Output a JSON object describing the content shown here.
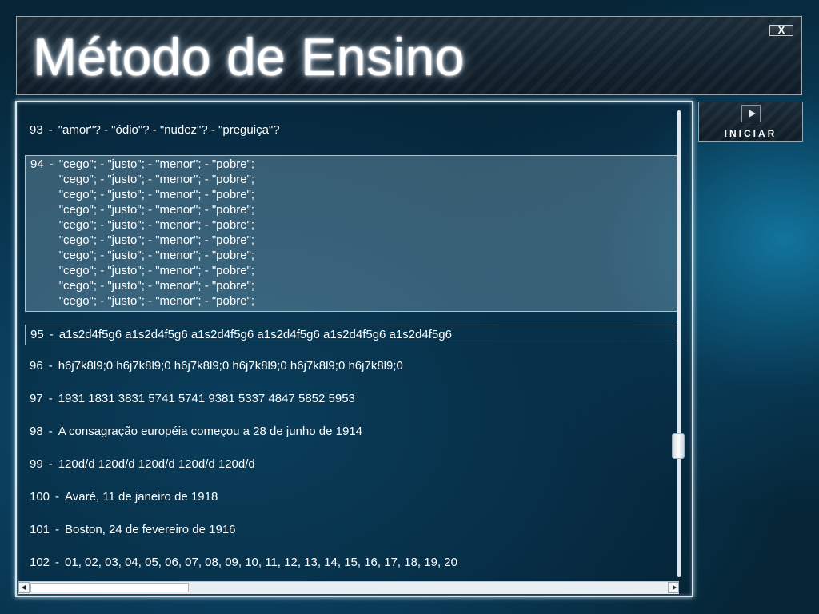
{
  "app": {
    "title": "Método de Ensino",
    "close_label": "X",
    "start_label": "INICIAR"
  },
  "icons": {
    "play": "play-icon",
    "scroll_left": "arrow-left-icon",
    "scroll_right": "arrow-right-icon"
  },
  "list": {
    "selected_number": "94",
    "items": [
      {
        "number": "93",
        "lines": [
          "\"amor\"? - \"ódio\"? - \"nudez\"? - \"preguiça\"?"
        ]
      },
      {
        "number": "94",
        "lines": [
          "\"cego\"; - \"justo\"; - \"menor\"; - \"pobre\";",
          "\"cego\"; - \"justo\"; - \"menor\"; - \"pobre\";",
          "\"cego\"; - \"justo\"; - \"menor\"; - \"pobre\";",
          "\"cego\"; - \"justo\"; - \"menor\"; - \"pobre\";",
          "\"cego\"; - \"justo\"; - \"menor\"; - \"pobre\";",
          "\"cego\"; - \"justo\"; - \"menor\"; - \"pobre\";",
          "\"cego\"; - \"justo\"; - \"menor\"; - \"pobre\";",
          "\"cego\"; - \"justo\"; - \"menor\"; - \"pobre\";",
          "\"cego\"; - \"justo\"; - \"menor\"; - \"pobre\";",
          "\"cego\"; - \"justo\"; - \"menor\"; - \"pobre\";"
        ]
      },
      {
        "number": "95",
        "lines": [
          "a1s2d4f5g6 a1s2d4f5g6 a1s2d4f5g6 a1s2d4f5g6 a1s2d4f5g6 a1s2d4f5g6"
        ]
      },
      {
        "number": "96",
        "lines": [
          "h6j7k8l9;0 h6j7k8l9;0 h6j7k8l9;0 h6j7k8l9;0 h6j7k8l9;0 h6j7k8l9;0"
        ]
      },
      {
        "number": "97",
        "lines": [
          "1931 1831 3831 5741 5741 9381 5337 4847 5852 5953"
        ]
      },
      {
        "number": "98",
        "lines": [
          "A consagração européia começou a 28 de junho de 1914"
        ]
      },
      {
        "number": "99",
        "lines": [
          "120d/d 120d/d 120d/d 120d/d 120d/d"
        ]
      },
      {
        "number": "100",
        "lines": [
          "Avaré, 11 de janeiro de 1918"
        ]
      },
      {
        "number": "101",
        "lines": [
          "Boston, 24 de fevereiro de 1916"
        ]
      },
      {
        "number": "102",
        "lines": [
          "01, 02, 03, 04, 05, 06, 07, 08, 09, 10, 11, 12, 13, 14, 15, 16, 17, 18, 19, 20"
        ]
      }
    ]
  },
  "scroll": {
    "vertical_position_fraction": 0.72,
    "horizontal_position_fraction": 0.0
  }
}
